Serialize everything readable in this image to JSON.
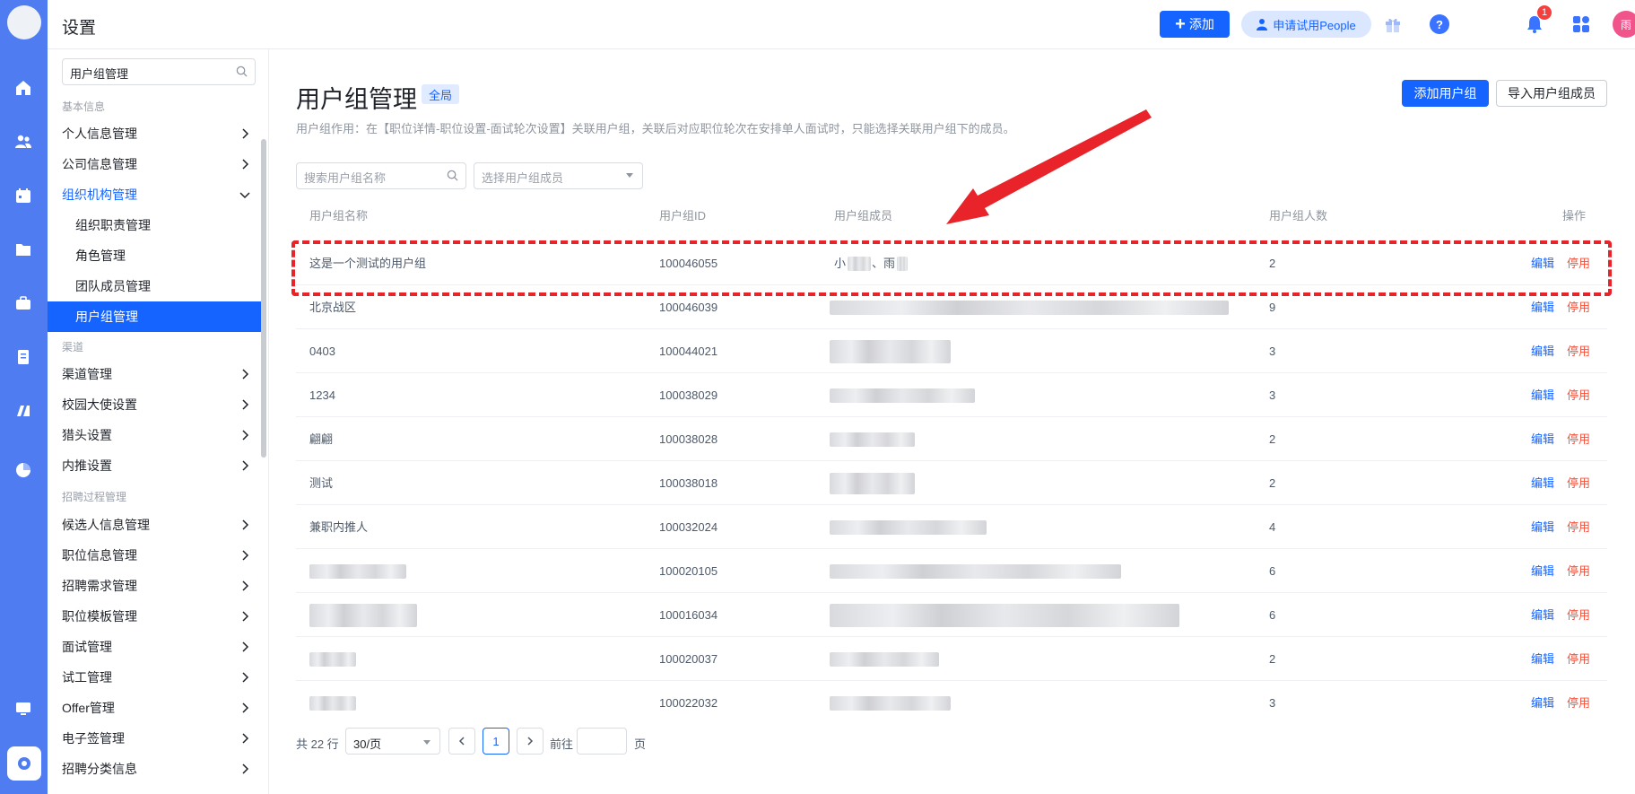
{
  "topbar": {
    "title": "设置",
    "add_label": "添加",
    "trial_label": "申请试用People",
    "notification_count": "1",
    "avatar_text": "雨"
  },
  "sidebar": {
    "search_value": "用户组管理",
    "sections": {
      "basic": "基本信息",
      "channel": "渠道",
      "process": "招聘过程管理"
    },
    "items": [
      {
        "label": "个人信息管理"
      },
      {
        "label": "公司信息管理"
      },
      {
        "label": "组织机构管理"
      },
      {
        "label": "组织职责管理"
      },
      {
        "label": "角色管理"
      },
      {
        "label": "团队成员管理"
      },
      {
        "label": "用户组管理"
      },
      {
        "label": "渠道管理"
      },
      {
        "label": "校园大使设置"
      },
      {
        "label": "猎头设置"
      },
      {
        "label": "内推设置"
      },
      {
        "label": "候选人信息管理"
      },
      {
        "label": "职位信息管理"
      },
      {
        "label": "招聘需求管理"
      },
      {
        "label": "职位模板管理"
      },
      {
        "label": "面试管理"
      },
      {
        "label": "试工管理"
      },
      {
        "label": "Offer管理"
      },
      {
        "label": "电子签管理"
      },
      {
        "label": "招聘分类信息"
      }
    ]
  },
  "main": {
    "title": "用户组管理",
    "scope_tag": "全局",
    "description": "用户组作用：在【职位详情-职位设置-面试轮次设置】关联用户组，关联后对应职位轮次在安排单人面试时，只能选择关联用户组下的成员。",
    "add_group_label": "添加用户组",
    "import_label": "导入用户组成员",
    "search_placeholder": "搜索用户组名称",
    "member_select_placeholder": "选择用户组成员"
  },
  "table": {
    "headers": [
      "用户组名称",
      "用户组ID",
      "用户组成员",
      "用户组人数",
      "操作"
    ],
    "edit_label": "编辑",
    "disable_label": "停用",
    "rows": [
      {
        "name": "这是一个测试的用户组",
        "id": "100046055",
        "members": "小",
        "members2": "、雨",
        "count": "2"
      },
      {
        "name": "北京战区",
        "id": "100046039",
        "members": "",
        "count": "9"
      },
      {
        "name": "0403",
        "id": "100044021",
        "members": "",
        "count": "3"
      },
      {
        "name": "1234",
        "id": "100038029",
        "members": "",
        "count": "3"
      },
      {
        "name": "翩翩",
        "id": "100038028",
        "members": "",
        "count": "2"
      },
      {
        "name": "测试",
        "id": "100038018",
        "members": "",
        "count": "2"
      },
      {
        "name": "兼职内推人",
        "id": "100032024",
        "members": "",
        "count": "4"
      },
      {
        "name": "",
        "id": "100020105",
        "members": "",
        "count": "6"
      },
      {
        "name": "",
        "id": "100016034",
        "members": "",
        "count": "6"
      },
      {
        "name": "",
        "id": "100020037",
        "members": "",
        "count": "2"
      },
      {
        "name": "",
        "id": "100022032",
        "members": "",
        "count": "3"
      }
    ]
  },
  "pagination": {
    "total": "共 22 行",
    "page_size": "30/页",
    "current_page": "1",
    "goto_label": "前往",
    "page_unit": "页"
  },
  "colors": {
    "accent": "#1664ff",
    "rail": "#4f7cf0",
    "danger": "#f5513b",
    "annotation": "#e8242a"
  }
}
